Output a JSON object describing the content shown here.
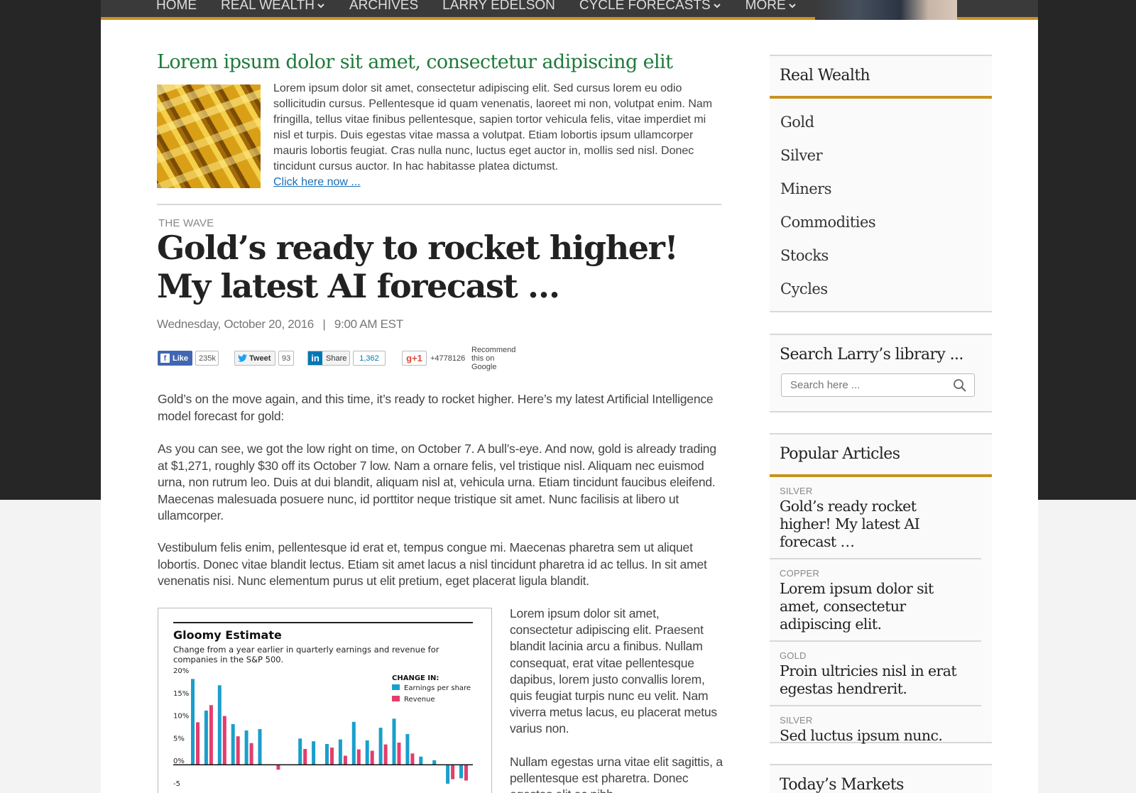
{
  "nav": {
    "items": [
      {
        "label": "HOME",
        "dropdown": false
      },
      {
        "label": "REAL WEALTH",
        "dropdown": true
      },
      {
        "label": "ARCHIVES",
        "dropdown": false
      },
      {
        "label": "LARRY EDELSON",
        "dropdown": false
      },
      {
        "label": "CYCLE FORECASTS",
        "dropdown": true
      },
      {
        "label": "MORE",
        "dropdown": true
      }
    ],
    "accent": "#c8921f"
  },
  "promo": {
    "title": "Lorem ipsum dolor sit amet, consectetur adipiscing elit",
    "text": "Lorem ipsum dolor sit amet, consectetur adipiscing elit. Sed cursus lorem eu odio sollicitudin cursus. Pellentesque id quam venenatis, laoreet mi non, volutpat enim. Nam fringilla, tellus vitae finibus pellentesque, sapien tortor vehicula felis, vitae imperdiet mi nisl et turpis. Duis egestas vitae massa a volutpat. Etiam lobortis ipsum ullamcorper mauris lobortis feugiat. Cras nulla nunc, luctus eget auctor in, mollis sed nisl. Donec tincidunt cursus auctor. In hac habitasse platea dictumst.",
    "link": "Click here now ...",
    "title_color": "#1e7a3a"
  },
  "article": {
    "kicker": "THE WAVE",
    "headline": "Gold’s ready to rocket higher! My latest AI forecast …",
    "date": "Wednesday, October 20, 2016",
    "separator": "|",
    "time": "9:00 AM EST",
    "p1": "Gold’s on the move again, and this time, it’s ready to rocket higher. Here’s my latest Artificial Intelligence model forecast for gold:",
    "p2": "As you can see, we got the low right on time, on October 7. A bull’s-eye. And now, gold is already trading at $1,271, roughly $30 off its October 7 low. Nam a ornare felis, vel tristique nisl. Aliquam nec euismod urna, non rutrum leo. Duis at dui blandit, aliquam nisl at, vehicula urna. Etiam tincidunt faucibus eleifend. Maecenas malesuada posuere nunc, id porttitor neque tristique sit amet. Nunc facilisis at libero ut ullamcorper.",
    "p3": "Vestibulum felis enim, pellentesque id erat et, tempus congue mi. Maecenas pharetra sem ut aliquet lobortis. Donec vitae blandit lectus. Etiam sit amet lacus a nisl tincidunt pharetra id ac tellus. In sit amet venenatis nisi. Nunc elementum purus ut elit pretium, eget placerat ligula blandit.",
    "side1": "Lorem ipsum dolor sit amet, consectetur adipiscing elit. Praesent blandit lacinia arcu a finibus. Nullam consequat, erat vitae pellentesque dapibus, lorem justo convallis lorem, quis feugiat turpis nunc eu velit. Nam viverra metus lacus, eu placerat metus varius non.",
    "side2": "Nullam egestas urna vitae elit sagittis, a pellentesque est pharetra. Donec egestas elit ac nibh"
  },
  "social": {
    "fb_label": "Like",
    "fb_glyph": "f",
    "fb_count": "235k",
    "tw_label": "Tweet",
    "tw_count": "93",
    "in_glyph": "in",
    "in_label": "Share",
    "in_count": "1,362",
    "gp_label": "g+1",
    "gp_count": "+4778126",
    "gp_rec": "Recommend this on Google"
  },
  "chart_data": {
    "type": "bar",
    "title": "Gloomy Estimate",
    "subtitle": "Change from a year earlier in quarterly earnings and revenue for companies in the S&P 500.",
    "legend_title": "CHANGE IN:",
    "ylim": [
      -5,
      20
    ],
    "yticks": [
      "20%",
      "15%",
      "10%",
      "5%",
      "0%",
      "-5"
    ],
    "ytick_values": [
      20,
      15,
      10,
      5,
      0,
      -5
    ],
    "series": [
      {
        "name": "Earnings per share",
        "color": "#1a9fcc",
        "values": [
          19,
          12,
          17.6,
          9,
          7.6,
          7.9,
          0,
          0,
          5.8,
          5.2,
          4.6,
          5.6,
          9.5,
          5.4,
          8.2,
          10.2,
          6.8,
          1.8,
          1,
          -4.2,
          -3
        ]
      },
      {
        "name": "Revenue",
        "color": "#e33e6b",
        "values": [
          9.4,
          13.2,
          10.8,
          6.3,
          4.8,
          0,
          -1.1,
          0,
          3.5,
          0,
          3.8,
          2,
          3.4,
          3.1,
          4.5,
          4.9,
          2.5,
          0,
          0,
          -3.2,
          -3.5
        ]
      }
    ],
    "grid": false,
    "legend": "top-right"
  },
  "sidebar": {
    "real_wealth": {
      "title": "Real Wealth",
      "items": [
        "Gold",
        "Silver",
        "Miners",
        "Commodities",
        "Stocks",
        "Cycles"
      ]
    },
    "search": {
      "title": "Search Larry’s library ...",
      "placeholder": "Search here ..."
    },
    "popular": {
      "title": "Popular Articles",
      "items": [
        {
          "cat": "SILVER",
          "title": "Gold’s ready rocket higher! My latest AI forecast …"
        },
        {
          "cat": "COPPER",
          "title": "Lorem ipsum dolor sit amet, consectetur adipiscing elit."
        },
        {
          "cat": "GOLD",
          "title": "Proin ultricies nisl in erat egestas hendrerit."
        },
        {
          "cat": "SILVER",
          "title": "Sed luctus ipsum nunc."
        }
      ]
    },
    "markets": {
      "title": "Today’s Markets"
    }
  }
}
